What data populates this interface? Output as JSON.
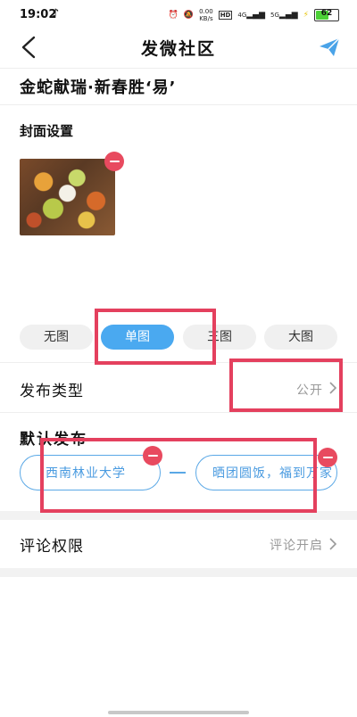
{
  "status_bar": {
    "time": "19:02",
    "net_speed_value": "0.00",
    "net_speed_unit": "KB/s",
    "hd_label": "HD",
    "signal_4g": "4G",
    "signal_5g": "5G",
    "battery": "62",
    "battery_level": 0.62
  },
  "nav": {
    "title": "发微社区"
  },
  "post": {
    "title": "金蛇献瑞·新春胜‘易’"
  },
  "cover": {
    "label": "封面设置"
  },
  "layout_options": [
    {
      "label": "无图",
      "selected": false
    },
    {
      "label": "单图",
      "selected": true
    },
    {
      "label": "三图",
      "selected": false
    },
    {
      "label": "大图",
      "selected": false
    }
  ],
  "publish_type": {
    "label": "发布类型",
    "value": "公开"
  },
  "default_publish": {
    "label": "默认发布",
    "tags": [
      "西南林业大学",
      "晒团圆饭，福到万家"
    ]
  },
  "comment_permission": {
    "label": "评论权限",
    "value": "评论开启"
  },
  "colors": {
    "accent": "#4aa9f0",
    "remove": "#e84a5f",
    "annotation": "#e4405e"
  }
}
